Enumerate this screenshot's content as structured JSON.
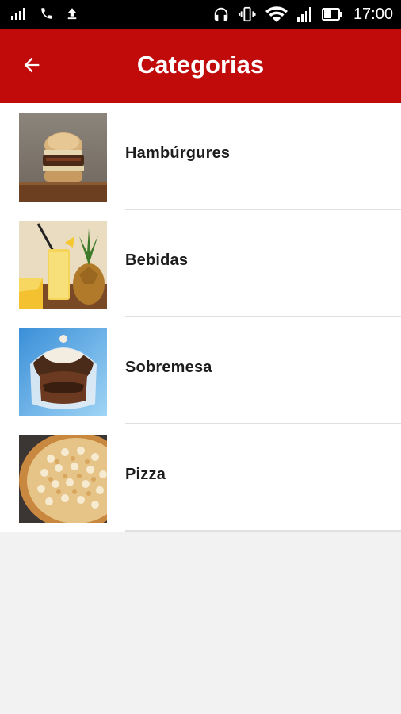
{
  "status_bar": {
    "time": "17:00",
    "icons": [
      "signal-icon",
      "phone-icon",
      "upload-icon",
      "headset-icon",
      "vibrate-icon",
      "wifi-icon",
      "cell-signal-icon",
      "battery-icon"
    ]
  },
  "app_bar": {
    "title": "Categorias",
    "back_icon": "arrow-left-icon",
    "color": "#c10a0a"
  },
  "categories": [
    {
      "label": "Hambúrgures",
      "image": "burger"
    },
    {
      "label": "Bebidas",
      "image": "pineapple-drink"
    },
    {
      "label": "Sobremesa",
      "image": "chocolate-sundae"
    },
    {
      "label": "Pizza",
      "image": "pizza"
    }
  ]
}
